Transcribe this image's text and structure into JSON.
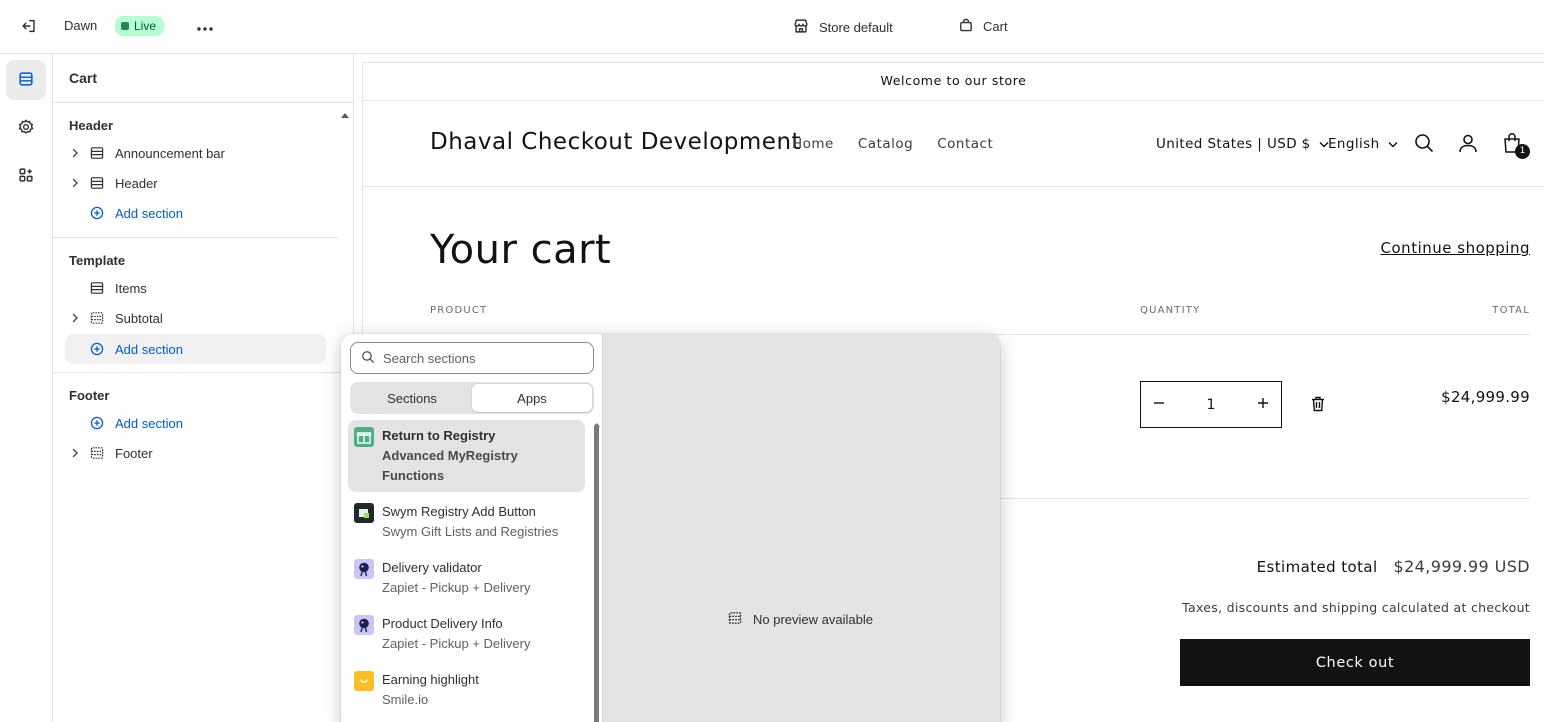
{
  "topbar": {
    "theme_name": "Dawn",
    "live_badge": "Live",
    "page_select": "Store default",
    "template_select": "Cart"
  },
  "panel": {
    "title": "Cart",
    "groups": [
      {
        "title": "Header",
        "items": [
          {
            "label": "Announcement bar",
            "expandable": true,
            "icon": "section-icon"
          },
          {
            "label": "Header",
            "expandable": true,
            "icon": "section-icon"
          },
          {
            "label": "Add section",
            "add": true
          }
        ]
      },
      {
        "title": "Template",
        "items": [
          {
            "label": "Items",
            "expandable": false,
            "icon": "section-icon"
          },
          {
            "label": "Subtotal",
            "expandable": true,
            "icon": "section-icon"
          },
          {
            "label": "Add section",
            "add": true,
            "hovered": true
          }
        ]
      },
      {
        "title": "Footer",
        "items": [
          {
            "label": "Add section",
            "add": true
          },
          {
            "label": "Footer",
            "expandable": true,
            "icon": "section-icon"
          }
        ]
      }
    ]
  },
  "picker": {
    "search_placeholder": "Search sections",
    "tabs": [
      "Sections",
      "Apps"
    ],
    "active_tab": "Apps",
    "apps": [
      {
        "name": "Return to Registry",
        "sub1": "Advanced MyRegistry",
        "sub2": "Functions",
        "logo_color": "#4caf87",
        "icon": "gift-icon",
        "selected": true
      },
      {
        "name": "Swym Registry Add Button",
        "sub1": "Swym Gift Lists and Registries",
        "logo_color": "#1e2a2b",
        "icon": "swym-icon"
      },
      {
        "name": "Delivery validator",
        "sub1": "Zapiet - Pickup + Delivery",
        "logo_color": "#3b3f9e",
        "icon": "zapiet-icon"
      },
      {
        "name": "Product Delivery Info",
        "sub1": "Zapiet - Pickup + Delivery",
        "logo_color": "#3b3f9e",
        "icon": "zapiet-icon"
      },
      {
        "name": "Earning highlight",
        "sub1": "Smile.io",
        "logo_color": "#fbbf24",
        "icon": "smile-icon"
      }
    ],
    "no_preview": "No preview available"
  },
  "store": {
    "announcement": "Welcome to our store",
    "logo": "Dhaval Checkout Development",
    "nav": [
      "Home",
      "Catalog",
      "Contact"
    ],
    "currency": "United States | USD $",
    "language": "English",
    "cart_count": "1",
    "cart_title": "Your cart",
    "continue_shopping": "Continue shopping",
    "col_product": "PRODUCT",
    "col_quantity": "QUANTITY",
    "col_total": "TOTAL",
    "quantity": "1",
    "line_total": "$24,999.99",
    "estimated_label": "Estimated total",
    "estimated_value": "$24,999.99 USD",
    "tax_note": "Taxes, discounts and shipping calculated at checkout",
    "checkout": "Check out"
  },
  "colors": {
    "accent": "#005bd3",
    "live_bg": "#b4fed2",
    "checkout_bg": "#121212"
  }
}
